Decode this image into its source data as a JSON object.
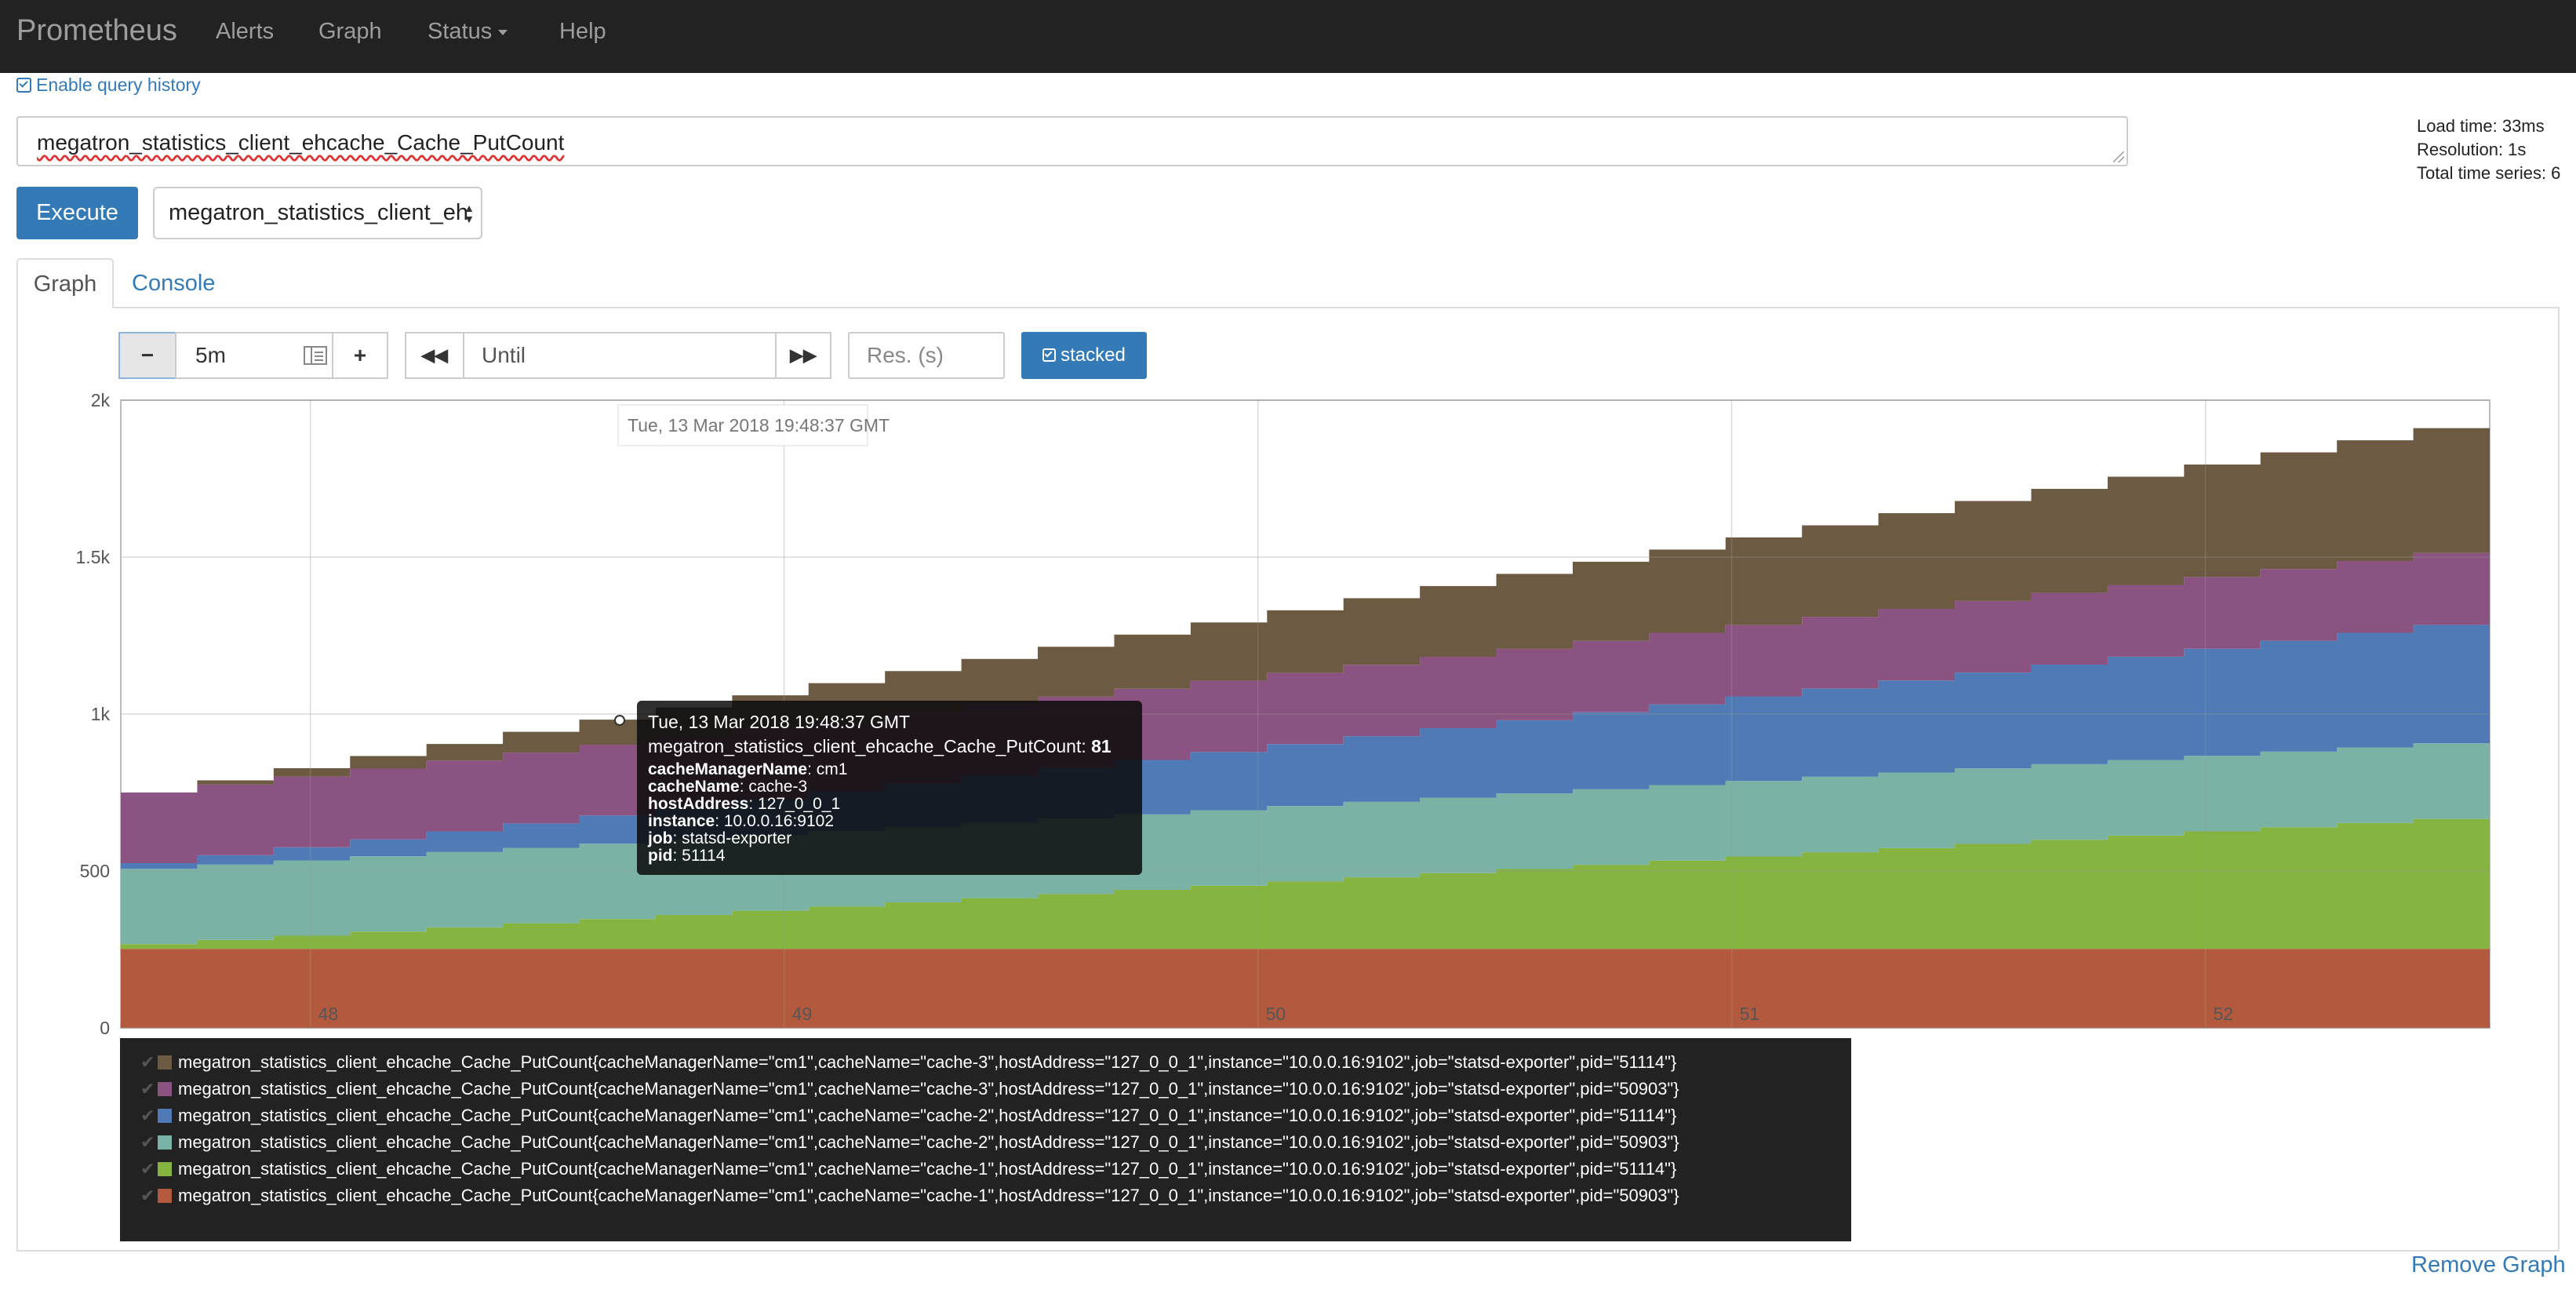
{
  "navbar": {
    "brand": "Prometheus",
    "links": [
      "Alerts",
      "Graph",
      "Status",
      "Help"
    ]
  },
  "history_toggle": "Enable query history",
  "expression": "megatron_statistics_client_ehcache_Cache_PutCount",
  "stats": {
    "load_time": "Load time: 33ms",
    "resolution": "Resolution: 1s",
    "total_series": "Total time series: 6"
  },
  "execute_label": "Execute",
  "metric_select_value": "megatron_statistics_client_eh",
  "tabs": {
    "graph": "Graph",
    "console": "Console"
  },
  "controls": {
    "range": "5m",
    "until_placeholder": "Until",
    "resolution_placeholder": "Res. (s)",
    "stacked_label": "stacked"
  },
  "hover_time_label": "Tue, 13 Mar 2018 19:48:37 GMT",
  "tooltip": {
    "time": "Tue, 13 Mar 2018 19:48:37 GMT",
    "metric_line": "megatron_statistics_client_ehcache_Cache_PutCount:",
    "value": "81",
    "labels": [
      {
        "key": "cacheManagerName",
        "value": "cm1"
      },
      {
        "key": "cacheName",
        "value": "cache-3"
      },
      {
        "key": "hostAddress",
        "value": "127_0_0_1"
      },
      {
        "key": "instance",
        "value": "10.0.0.16:9102"
      },
      {
        "key": "job",
        "value": "statsd-exporter"
      },
      {
        "key": "pid",
        "value": "51114"
      }
    ]
  },
  "remove_graph": "Remove Graph",
  "chart_data": {
    "type": "area",
    "stacked": true,
    "grid": true,
    "y_ticks": [
      "0",
      "500",
      "1k",
      "1.5k",
      "2k"
    ],
    "x_ticks": [
      "48",
      "49",
      "50",
      "51",
      "52"
    ],
    "ylim": [
      0,
      2000
    ],
    "xlim": [
      47.6,
      52.6
    ],
    "x_tick_values": [
      48,
      49,
      50,
      51,
      52
    ],
    "series": [
      {
        "name": "megatron_statistics_client_ehcache_Cache_PutCount{cacheManagerName=\"cm1\",cacheName=\"cache-1\",hostAddress=\"127_0_0_1\",instance=\"10.0.0.16:9102\",job=\"statsd-exporter\",pid=\"50903\"}",
        "color": "#b35a3e",
        "start": 252,
        "end": 252
      },
      {
        "name": "megatron_statistics_client_ehcache_Cache_PutCount{cacheManagerName=\"cm1\",cacheName=\"cache-1\",hostAddress=\"127_0_0_1\",instance=\"10.0.0.16:9102\",job=\"statsd-exporter\",pid=\"51114\"}",
        "color": "#86b440",
        "start": 15,
        "end": 414
      },
      {
        "name": "megatron_statistics_client_ehcache_Cache_PutCount{cacheManagerName=\"cm1\",cacheName=\"cache-2\",hostAddress=\"127_0_0_1\",instance=\"10.0.0.16:9102\",job=\"statsd-exporter\",pid=\"50903\"}",
        "color": "#7ab2a6",
        "start": 240,
        "end": 241
      },
      {
        "name": "megatron_statistics_client_ehcache_Cache_PutCount{cacheManagerName=\"cm1\",cacheName=\"cache-2\",hostAddress=\"127_0_0_1\",instance=\"10.0.0.16:9102\",job=\"statsd-exporter\",pid=\"51114\"}",
        "color": "#4f7ab5",
        "start": 18,
        "end": 377
      },
      {
        "name": "megatron_statistics_client_ehcache_Cache_PutCount{cacheManagerName=\"cm1\",cacheName=\"cache-3\",hostAddress=\"127_0_0_1\",instance=\"10.0.0.16:9102\",job=\"statsd-exporter\",pid=\"50903\"}",
        "color": "#8a5381",
        "start": 225,
        "end": 229
      },
      {
        "name": "megatron_statistics_client_ehcache_Cache_PutCount{cacheManagerName=\"cm1\",cacheName=\"cache-3\",hostAddress=\"127_0_0_1\",instance=\"10.0.0.16:9102\",job=\"statsd-exporter\",pid=\"51114\"}",
        "color": "#6d5a43",
        "start": 0,
        "end": 398
      }
    ]
  }
}
